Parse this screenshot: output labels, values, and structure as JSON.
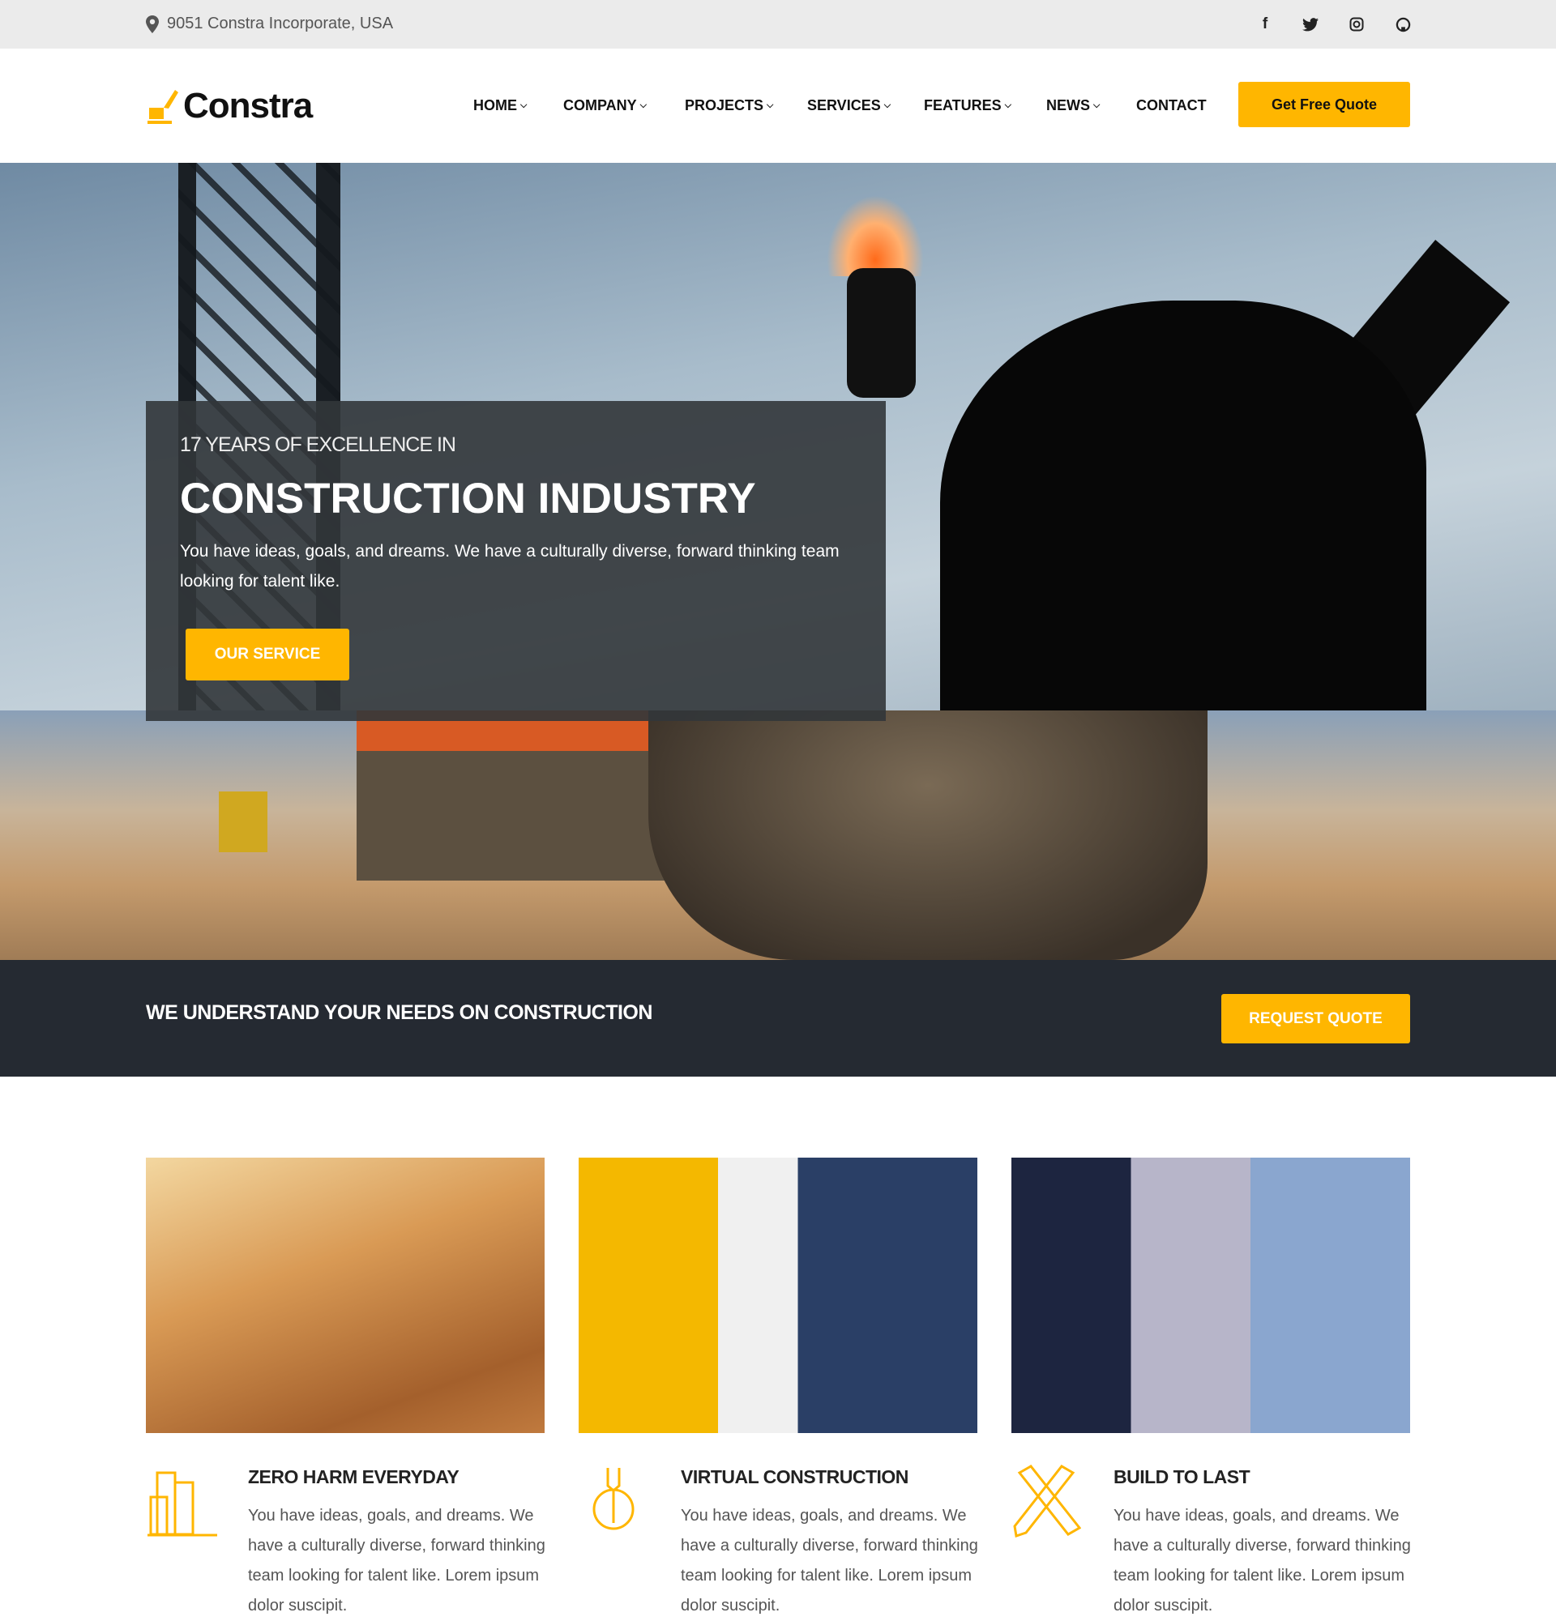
{
  "topbar": {
    "address": "9051 Constra Incorporate, USA",
    "icons": [
      "location-pin-icon",
      "facebook-icon",
      "twitter-icon",
      "instagram-icon",
      "github-icon"
    ]
  },
  "header": {
    "logo": "Constra",
    "nav": [
      {
        "label": "HOME"
      },
      {
        "label": "COMPANY"
      },
      {
        "label": "PROJECTS"
      },
      {
        "label": "SERVICES"
      },
      {
        "label": "FEATURES"
      },
      {
        "label": "NEWS"
      },
      {
        "label": "CONTACT"
      }
    ],
    "quote_button": "Get Free Quote"
  },
  "hero": {
    "subtitle": "17 YEARS OF EXCELLENCE IN",
    "title": "CONSTRUCTION INDUSTRY",
    "text": "You have ideas, goals, and dreams. We have a culturally diverse, forward thinking team looking for talent like.",
    "button": "OUR SERVICE"
  },
  "band": {
    "text": "WE UNDERSTAND YOUR NEEDS ON CONSTRUCTION",
    "button": "REQUEST QUOTE"
  },
  "features": [
    {
      "title": "ZERO HARM EVERYDAY",
      "text": "You have ideas, goals, and dreams. We have a culturally diverse, forward thinking team looking for talent like. Lorem ipsum dolor suscipit.",
      "icon": "buildings-icon"
    },
    {
      "title": "VIRTUAL CONSTRUCTION",
      "text": "You have ideas, goals, and dreams. We have a culturally diverse, forward thinking team looking for talent like. Lorem ipsum dolor suscipit.",
      "icon": "wrench-gear-icon"
    },
    {
      "title": "BUILD TO LAST",
      "text": "You have ideas, goals, and dreams. We have a culturally diverse, forward thinking team looking for talent like. Lorem ipsum dolor suscipit.",
      "icon": "ruler-pencil-icon"
    }
  ],
  "colors": {
    "accent": "#ffb600",
    "dark": "#252a32",
    "topbar": "#ebebeb"
  }
}
